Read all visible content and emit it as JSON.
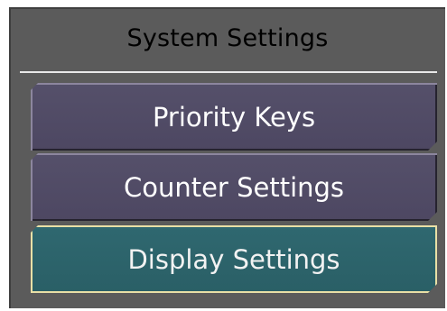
{
  "title": "System Settings",
  "buttons": [
    {
      "label": "Priority Keys",
      "selected": false
    },
    {
      "label": "Counter Settings",
      "selected": false
    },
    {
      "label": "Display Settings",
      "selected": true
    }
  ],
  "colors": {
    "panel": "#5b5b5b",
    "button_normal": "#524c67",
    "button_selected": "#2d646b",
    "selected_border": "#e9e0a6",
    "divider": "#e8e8e8"
  }
}
